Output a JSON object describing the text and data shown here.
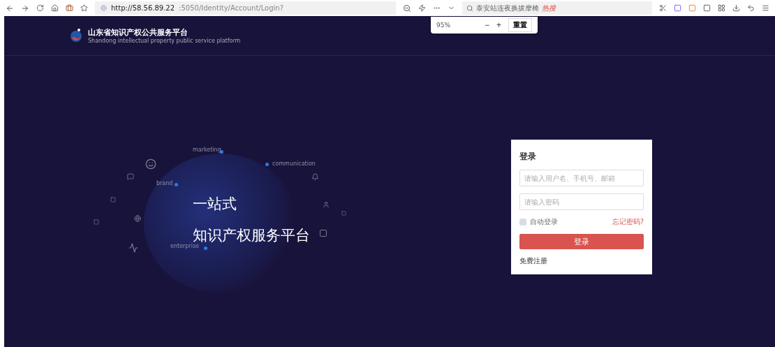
{
  "browser": {
    "url_host": "http://58.56.89.22",
    "url_rest": ":5050/Identity/Account/Login?",
    "search_text": "泰安站连夜换拔摩椅",
    "search_badge": "热搜"
  },
  "zoom_popup": {
    "percent": "95%",
    "minus": "−",
    "plus": "+",
    "reset": "重置"
  },
  "header": {
    "title": "山东省知识产权公共服务平台",
    "subtitle": "Shandong intellectual property public service platform"
  },
  "hero": {
    "tags": [
      "marketing",
      "communication",
      "brand",
      "enterprise"
    ],
    "line1": "一站式",
    "line2": "知识产权服务平台"
  },
  "login": {
    "title": "登录",
    "username": {
      "placeholder": "请输入用户名、手机号、邮箱"
    },
    "password": {
      "placeholder": "请输入密码"
    },
    "auto_login": {
      "label": "自动登录",
      "checked": false
    },
    "forgot": "忘记密码?",
    "submit": "登录",
    "register": "免费注册"
  }
}
